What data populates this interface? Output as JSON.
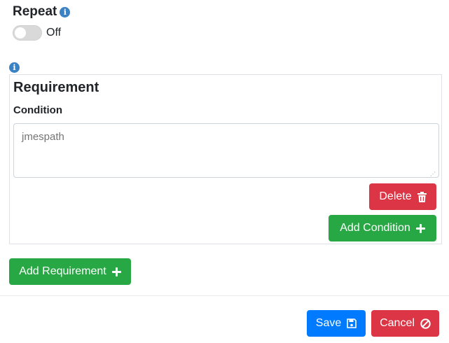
{
  "repeat": {
    "title": "Repeat",
    "toggle_state_label": "Off",
    "enabled": false
  },
  "requirement": {
    "heading": "Requirement",
    "condition_label": "Condition",
    "condition_placeholder": "jmespath",
    "condition_value": "",
    "delete_label": "Delete",
    "add_condition_label": "Add Condition"
  },
  "actions": {
    "add_requirement_label": "Add Requirement",
    "save_label": "Save",
    "cancel_label": "Cancel"
  },
  "colors": {
    "danger": "#dc3545",
    "success": "#28a745",
    "primary": "#007bff",
    "info": "#3b82c4"
  },
  "icons": {
    "info": "info-icon",
    "trash": "trash-icon",
    "plus": "plus-icon",
    "save": "floppy-disk-icon",
    "cancel": "ban-icon"
  }
}
